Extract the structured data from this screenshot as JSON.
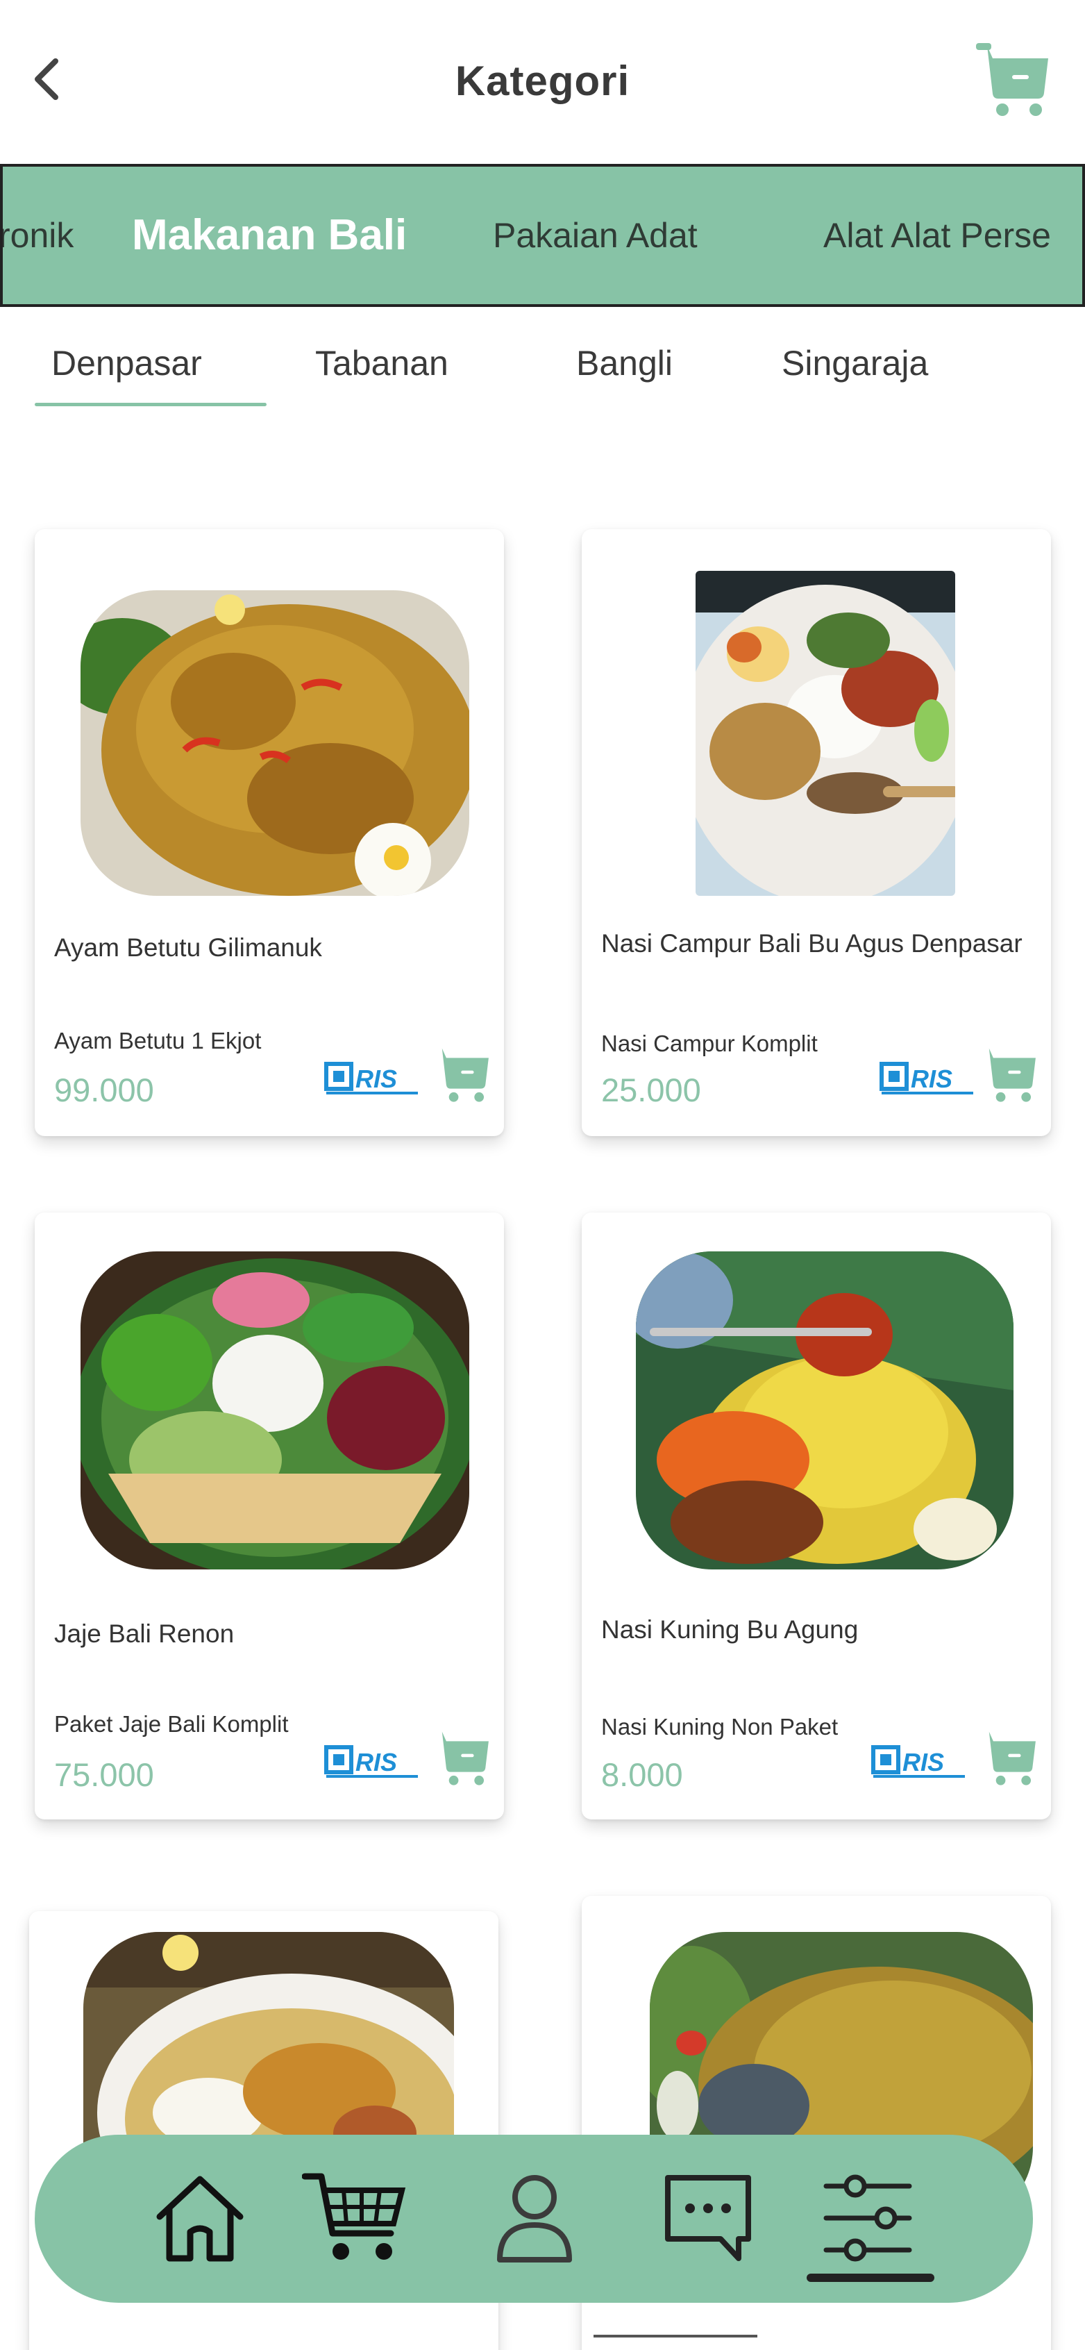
{
  "header": {
    "title": "Kategori",
    "back_icon": "chevron-left-icon",
    "cart_icon": "cart-icon"
  },
  "categories": [
    {
      "label": "ronik",
      "active": false
    },
    {
      "label": "Makanan Bali",
      "active": true
    },
    {
      "label": "Pakaian Adat",
      "active": false
    },
    {
      "label": "Alat Alat Perse",
      "active": false
    }
  ],
  "subtabs": [
    {
      "label": "Denpasar",
      "active": true
    },
    {
      "label": "Tabanan",
      "active": false
    },
    {
      "label": "Bangli",
      "active": false
    },
    {
      "label": "Singaraja",
      "active": false
    }
  ],
  "products": [
    {
      "name": "Ayam Betutu Gilimanuk",
      "variant": "Ayam Betutu 1 Ekjot",
      "price": "99.000",
      "payment_logo": "qris-logo",
      "image": "ayam-betutu-photo"
    },
    {
      "name": "Nasi Campur Bali Bu Agus Denpasar",
      "variant": "Nasi Campur Komplit",
      "price": "25.000",
      "payment_logo": "qris-logo",
      "image": "nasi-campur-photo"
    },
    {
      "name": "Jaje Bali Renon",
      "variant": "Paket Jaje Bali Komplit",
      "price": "75.000",
      "payment_logo": "qris-logo",
      "image": "jaje-bali-photo"
    },
    {
      "name": "Nasi Kuning Bu Agung",
      "variant": "Nasi Kuning Non Paket",
      "price": "8.000",
      "payment_logo": "qris-logo",
      "image": "nasi-kuning-photo"
    },
    {
      "image": "soup-bowl-photo"
    },
    {
      "image": "grilled-fish-photo"
    }
  ],
  "bottom_nav": [
    {
      "icon": "home-icon"
    },
    {
      "icon": "shopping-cart-icon"
    },
    {
      "icon": "user-icon"
    },
    {
      "icon": "chat-icon"
    },
    {
      "icon": "sliders-icon",
      "active": true
    }
  ],
  "colors": {
    "accent": "#87c3a6",
    "price": "#8cc4a9",
    "qris_blue": "#1e8fd6"
  }
}
